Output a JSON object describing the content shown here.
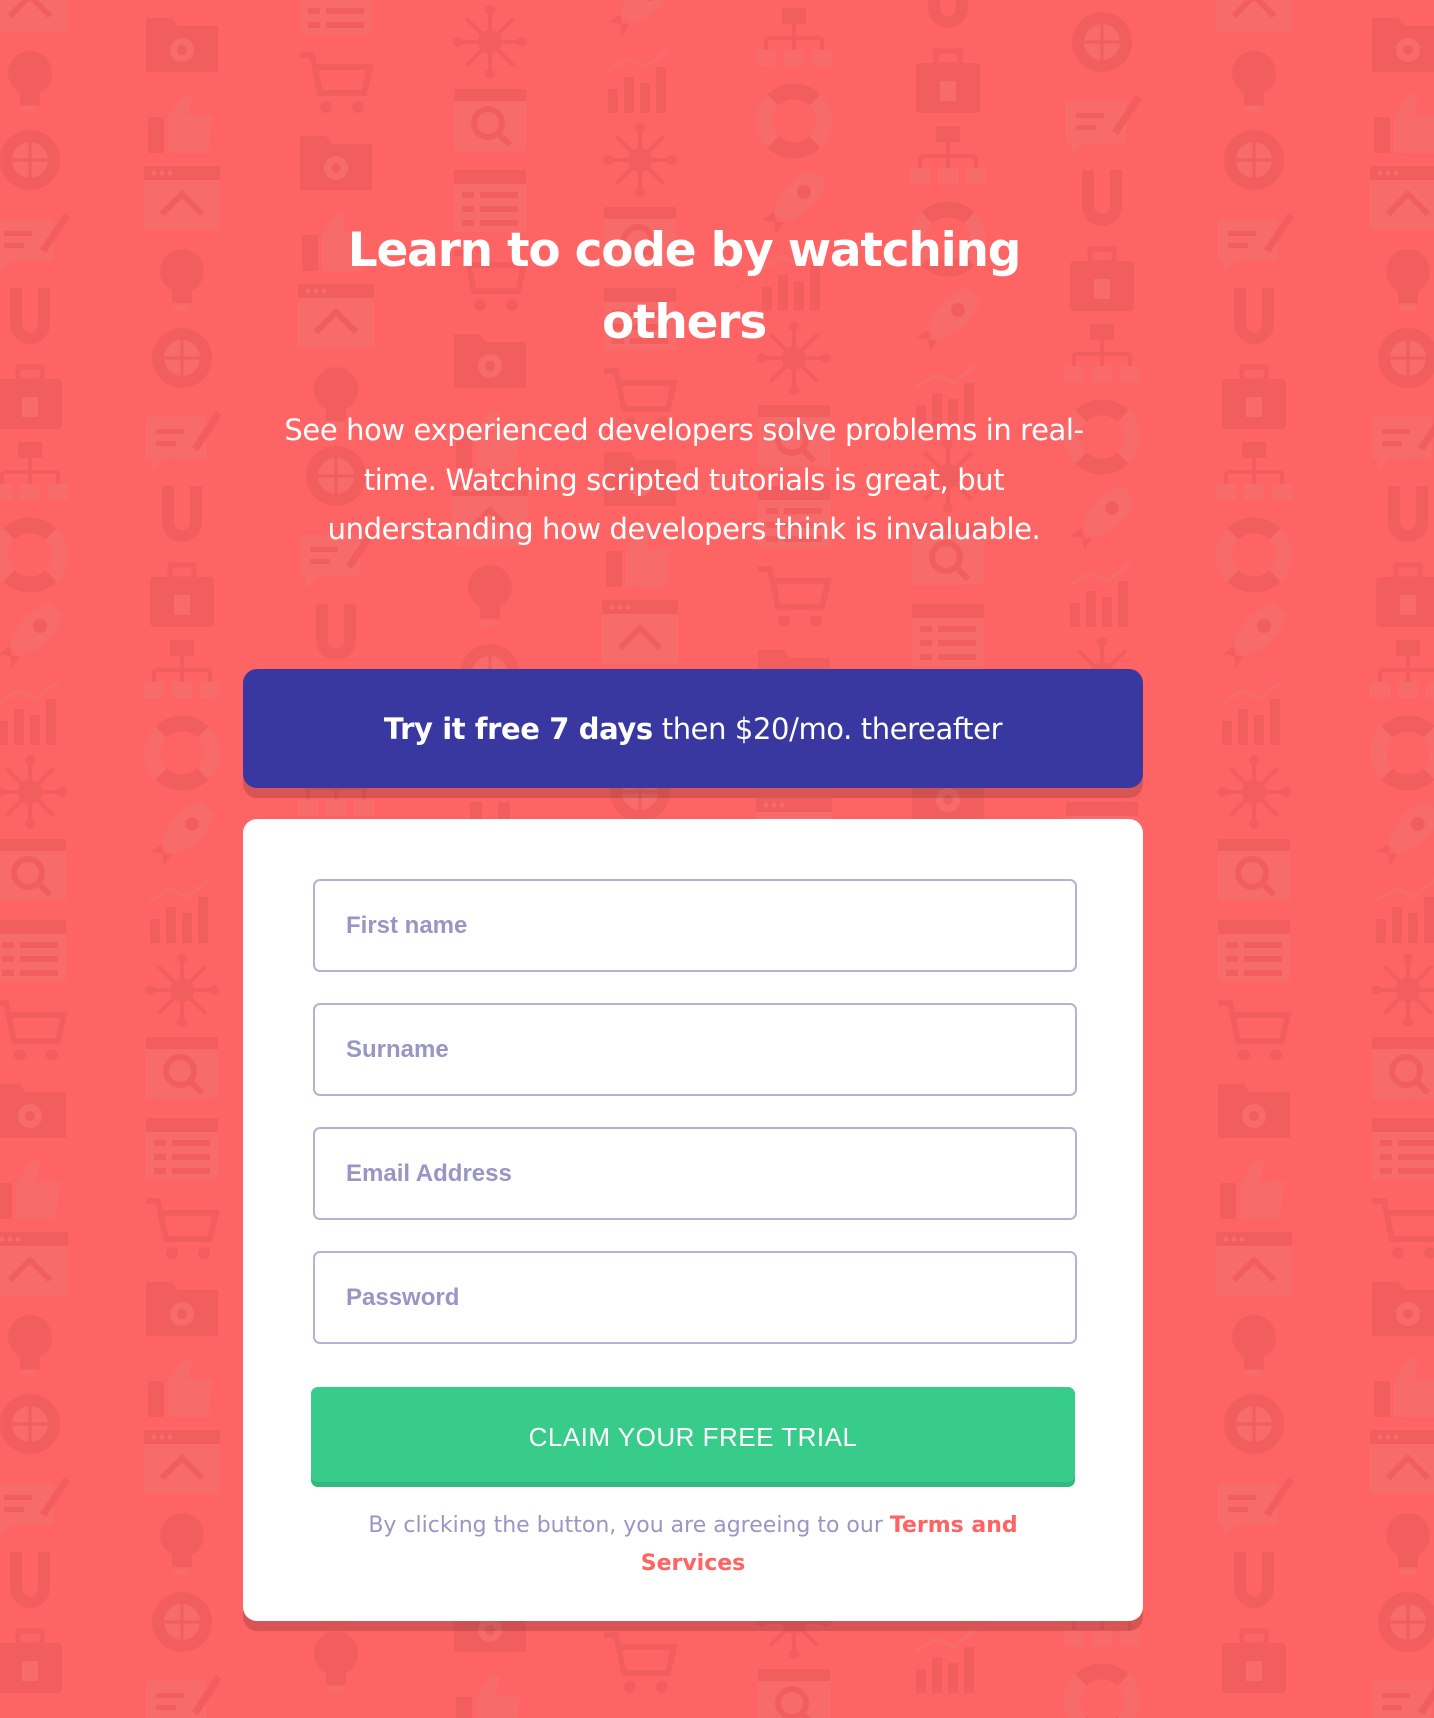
{
  "hero": {
    "title": "Learn to code by watching others",
    "description": "See how experienced developers solve problems in real-time. Watching scripted tutorials is great, but understanding how developers think is invaluable."
  },
  "promo": {
    "strong": "Try it free 7 days",
    "rest": "then $20/mo. thereafter"
  },
  "form": {
    "first_name_placeholder": "First name",
    "surname_placeholder": "Surname",
    "email_placeholder": "Email Address",
    "password_placeholder": "Password",
    "submit_label": "CLAIM YOUR FREE TRIAL",
    "terms_prefix": "By clicking the button, you are agreeing to our",
    "terms_link": "Terms and Services"
  },
  "colors": {
    "background": "#ff6464",
    "banner": "#3938a0",
    "submit": "#38cc8b",
    "field_border": "#b4b1d4",
    "placeholder": "#9896c4",
    "terms_link": "#ff6464"
  },
  "background_icons": [
    "browser-icon",
    "toolbox-icon",
    "network-icon",
    "thumbs-up-icon",
    "magnet-icon",
    "chart-icon",
    "folder-gear-icon",
    "chat-pencil-icon",
    "rocket-icon",
    "cart-icon",
    "globe-gear-icon",
    "lifebuoy-icon",
    "calendar-list-icon",
    "lightbulb-icon",
    "sitemap-icon",
    "search-icon"
  ]
}
